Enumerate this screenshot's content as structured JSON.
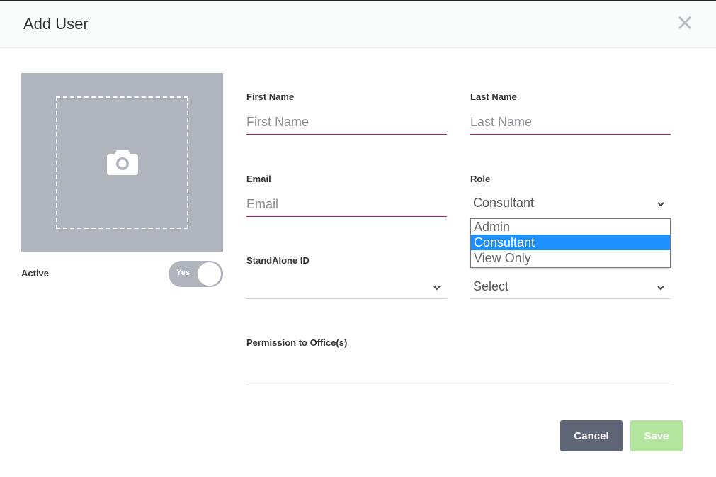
{
  "header": {
    "title": "Add User",
    "close_icon": "close-icon"
  },
  "photo": {
    "icon": "camera-icon"
  },
  "active": {
    "label": "Active",
    "toggle_text": "Yes"
  },
  "fields": {
    "first_name": {
      "label": "First Name",
      "placeholder": "First Name",
      "value": ""
    },
    "last_name": {
      "label": "Last Name",
      "placeholder": "Last Name",
      "value": ""
    },
    "email": {
      "label": "Email",
      "placeholder": "Email",
      "value": ""
    },
    "role": {
      "label": "Role",
      "value": "Consultant"
    },
    "standalone_id": {
      "label": "StandAlone ID",
      "value": ""
    },
    "second_select": {
      "value": "Select"
    },
    "permission": {
      "label": "Permission to Office(s)"
    }
  },
  "role_options": [
    "Admin",
    "Consultant",
    "View Only"
  ],
  "role_selected": "Consultant",
  "buttons": {
    "cancel": "Cancel",
    "save": "Save"
  },
  "colors": {
    "accent_underline": "#c2185b",
    "cancel_bg": "#5e6577",
    "save_bg": "#b3e59e",
    "selected_option": "#1e90ff"
  }
}
